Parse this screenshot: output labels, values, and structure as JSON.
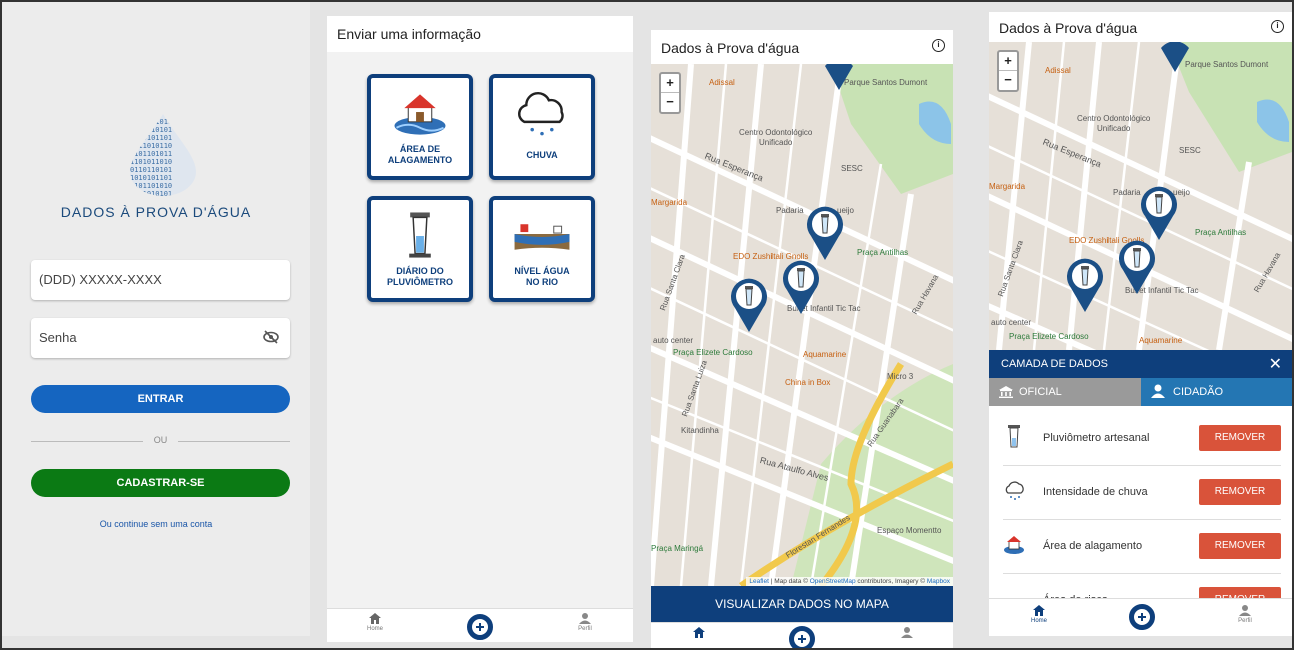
{
  "login": {
    "brand": "DADOS À PROVA D'ÁGUA",
    "phone_placeholder": "(DDD) XXXXX-XXXX",
    "password_placeholder": "Senha",
    "enter_label": "ENTRAR",
    "or_label": "OU",
    "register_label": "CADASTRAR-SE",
    "continue_label": "Ou continue sem uma conta"
  },
  "report": {
    "title": "Enviar uma informação",
    "cards": [
      {
        "label1": "ÁREA DE",
        "label2": "ALAGAMENTO"
      },
      {
        "label1": "CHUVA",
        "label2": ""
      },
      {
        "label1": "DIÁRIO DO",
        "label2": "PLUVIÔMETRO"
      },
      {
        "label1": "NÍVEL ÁGUA",
        "label2": "NO RIO"
      }
    ]
  },
  "nav": {
    "home": "Home",
    "profile": "Perfil"
  },
  "map": {
    "title": "Dados à Prova d'água",
    "zoom_in": "+",
    "zoom_out": "−",
    "view_button": "VISUALIZAR DADOS NO MAPA",
    "attribution_leaflet": "Leaflet",
    "attribution_text": " | Map data © ",
    "attribution_osm": "OpenStreetMap",
    "attribution_rest": " contributors, Imagery © ",
    "attribution_mapbox": "Mapbox",
    "labels": {
      "adissal": "Adissal",
      "parque": "Parque Santos Dumont",
      "centro": "Centro Odontológico",
      "unificado": "Unificado",
      "esperanca": "Rua Esperança",
      "sesc": "SESC",
      "margarida": "Margarida",
      "padaria": "Padaria",
      "queijo": "ueijo",
      "edo": "EDO Zushi",
      "itali": "Itali Gnolls",
      "antilhas": "Praça Antilhas",
      "santaclara": "Rua Santa Clara",
      "buffet": "Buffet Infantil Tic Tac",
      "havana": "Rua Havana",
      "autocenter": "auto center",
      "elizete": "Praça Elizete Cardoso",
      "aquamarine": "Aquamarine",
      "santaluiza": "Rua Santa Luiza",
      "china": "China in Box",
      "micro": "Micro 3",
      "guanabara": "Rua Guanabara",
      "kitandinha": "Kitandinha",
      "ataulfo": "Rua Ataulfo Alves",
      "florestan": "Florestan Fernandes",
      "momento": "Espaço Momentto",
      "maringa": "Praça Maringá"
    }
  },
  "layers": {
    "title": "CAMADA DE DADOS",
    "close": "✕",
    "tab_official": "OFICIAL",
    "tab_citizen": "CIDADÃO",
    "remove_label": "REMOVER",
    "items": [
      "Pluviômetro artesanal",
      "Intensidade de chuva",
      "Área de alagamento",
      "Área de risco"
    ]
  },
  "colors": {
    "primary": "#0e3f7c",
    "enter": "#1565c0",
    "register": "#0b7a14",
    "remove": "#d9533a",
    "citizen_tab": "#2476b3"
  }
}
